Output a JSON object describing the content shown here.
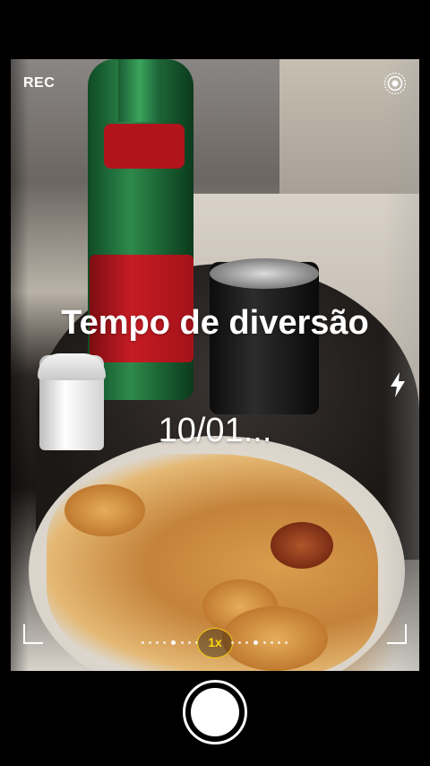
{
  "top_bar": {
    "rec_label": "REC",
    "live_icon": "live-photo-icon"
  },
  "side": {
    "flash_icon": "flash-icon"
  },
  "caption": {
    "title": "Tempo de diversão",
    "date": "10/01..."
  },
  "zoom": {
    "label": "1x"
  },
  "controls": {
    "shutter_icon": "shutter-button-icon"
  },
  "colors": {
    "zoom_accent": "#ffd60a",
    "text": "#ffffff",
    "background": "#000000"
  }
}
